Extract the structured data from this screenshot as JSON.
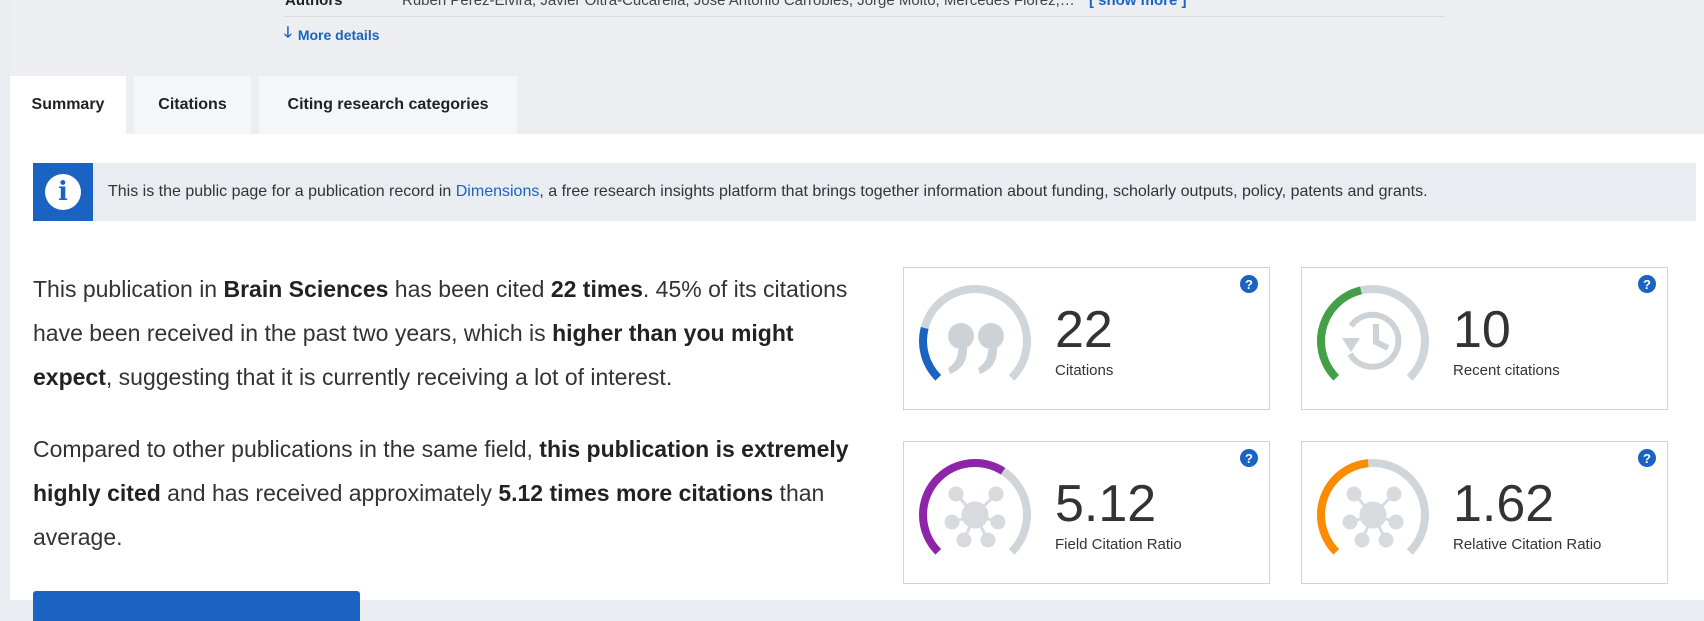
{
  "authors": {
    "label": "Authors",
    "names": "Rubén Pérez-Elvira, Javier Oltra-Cucarella, José Antonio Carrobles, Jorge Moltó, Mercedes Flórez,…",
    "show_more": "[ show more ]"
  },
  "more_details": "More details",
  "tabs": [
    {
      "label": "Summary",
      "active": true
    },
    {
      "label": "Citations",
      "active": false
    },
    {
      "label": "Citing research categories",
      "active": false
    }
  ],
  "info_banner": {
    "text_before": "This is the public page for a publication record in ",
    "link": "Dimensions",
    "text_after": ", a free research insights platform that brings together information about funding, scholarly outputs, policy, patents and grants."
  },
  "summary": {
    "p1": [
      "This publication in ",
      "Brain Sciences",
      " has been cited ",
      "22 times",
      ". 45% of its citations have been received in the past two years, which is ",
      "higher than you might expect",
      ", suggesting that it is currently receiving a lot of interest."
    ],
    "p2": [
      "Compared to other publications in the same field, ",
      "this publication is extremely highly cited",
      " and has received approximately ",
      "5.12 times more citations",
      " than average."
    ]
  },
  "metrics": [
    {
      "value": "22",
      "label": "Citations",
      "color": "#1a63c3",
      "fill": 0.22,
      "icon": "quote-icon"
    },
    {
      "value": "10",
      "label": "Recent citations",
      "color": "#43a047",
      "fill": 0.45,
      "icon": "clock-history-icon"
    },
    {
      "value": "5.12",
      "label": "Field Citation Ratio",
      "color": "#8e24aa",
      "fill": 0.62,
      "icon": "network-icon"
    },
    {
      "value": "1.62",
      "label": "Relative Citation Ratio",
      "color": "#fb8c00",
      "fill": 0.48,
      "icon": "network-icon"
    }
  ],
  "help_glyph": "?",
  "info_glyph": "i",
  "arrow_glyph": "🡓",
  "colors": {
    "accent": "#1a63c3",
    "track": "#d0d5da"
  }
}
